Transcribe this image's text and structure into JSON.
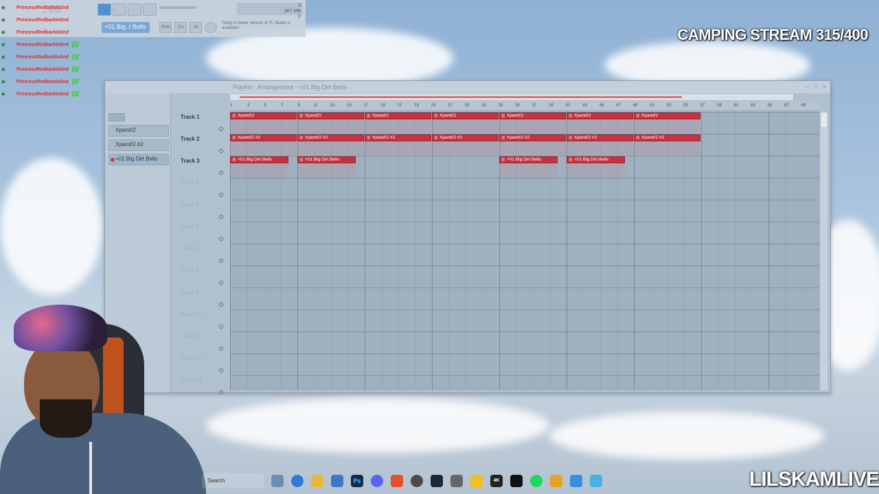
{
  "toolbar": {
    "time_display": ":00",
    "pattern_selector": "+01 Big..t Bells",
    "shift_label": "Shift",
    "ctrl_label": "Ctrl",
    "alt_label": "Alt",
    "memory_value": "367 MB",
    "cpu_value": "3",
    "poly_value": "0",
    "update_hint": "Today  A newer version of FL Studio is available!"
  },
  "chat": {
    "username": "PrincessRedbarbie2nd",
    "reaction": "W",
    "lines": 8
  },
  "overlay": {
    "stream_title": "CAMPING STREAM 315/400",
    "brand": "LILSKAMLIVE"
  },
  "playlist": {
    "title": "Playlist - Arrangement - +01 Big Dirt Bells",
    "patterns": [
      "Xpand!2",
      "Xpand!2 #2",
      "+01 Big Dirt Bells"
    ],
    "tracks": [
      "Track 1",
      "Track 2",
      "Track 3",
      "Track 4",
      "Track 5",
      "Track 6",
      "Track 7",
      "Track 8",
      "Track 9",
      "Track 10",
      "Track 11",
      "Track 12",
      "Track 13"
    ],
    "ruler_ticks": [
      "1",
      "3",
      "5",
      "7",
      "9",
      "11",
      "13",
      "15",
      "17",
      "19",
      "21",
      "23",
      "25",
      "27",
      "29",
      "31",
      "33",
      "35",
      "37",
      "39",
      "41",
      "43",
      "45",
      "47",
      "49",
      "51",
      "53",
      "55",
      "57",
      "59",
      "61",
      "63",
      "65",
      "67",
      "69"
    ],
    "clip_track1": "Xpand!2",
    "clip_track2": "Xpand!2 #2",
    "clip_track3": "+01 Big Dirt Bells"
  },
  "taskbar": {
    "search": "Search"
  }
}
